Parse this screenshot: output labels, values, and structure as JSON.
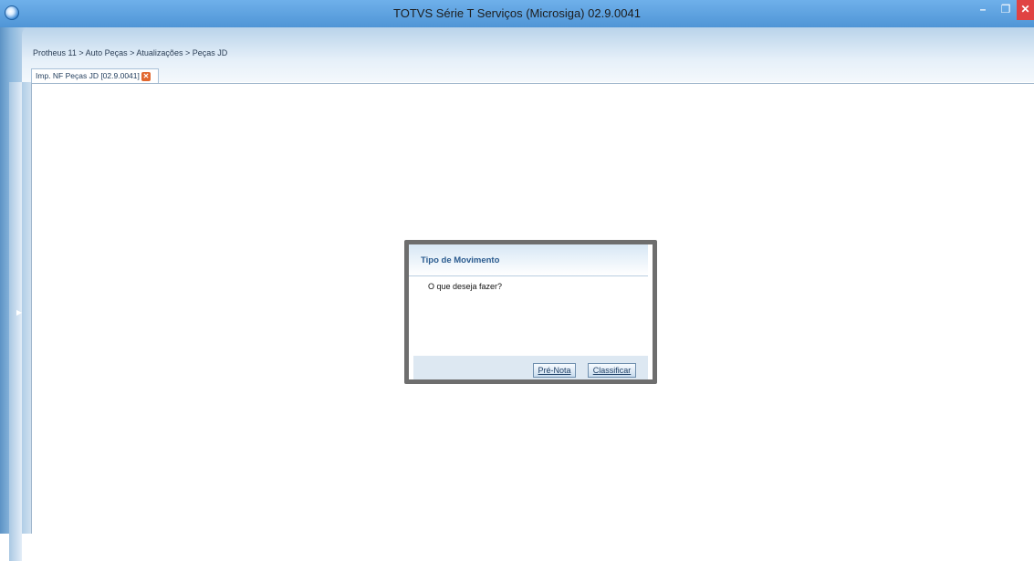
{
  "window": {
    "title": "TOTVS Série T Serviços (Microsiga) 02.9.0041",
    "minimize": "–",
    "maximize": "❐",
    "close": "✕"
  },
  "breadcrumb": "Protheus 11 > Auto Peças > Atualizações > Peças JD",
  "tab": {
    "label": "Imp. NF Peças JD [02.9.0041]",
    "close": "✕"
  },
  "dialog": {
    "title": "Tipo de Movimento",
    "message": "O que deseja fazer?",
    "buttons": {
      "pre_nota": "Pré-Nota",
      "classificar": "Classificar"
    }
  },
  "colors": {
    "titlebar": "#5da2e1",
    "close_button": "#e04343",
    "tab_close": "#e1672f",
    "dialog_title": "#2a5b8f"
  }
}
